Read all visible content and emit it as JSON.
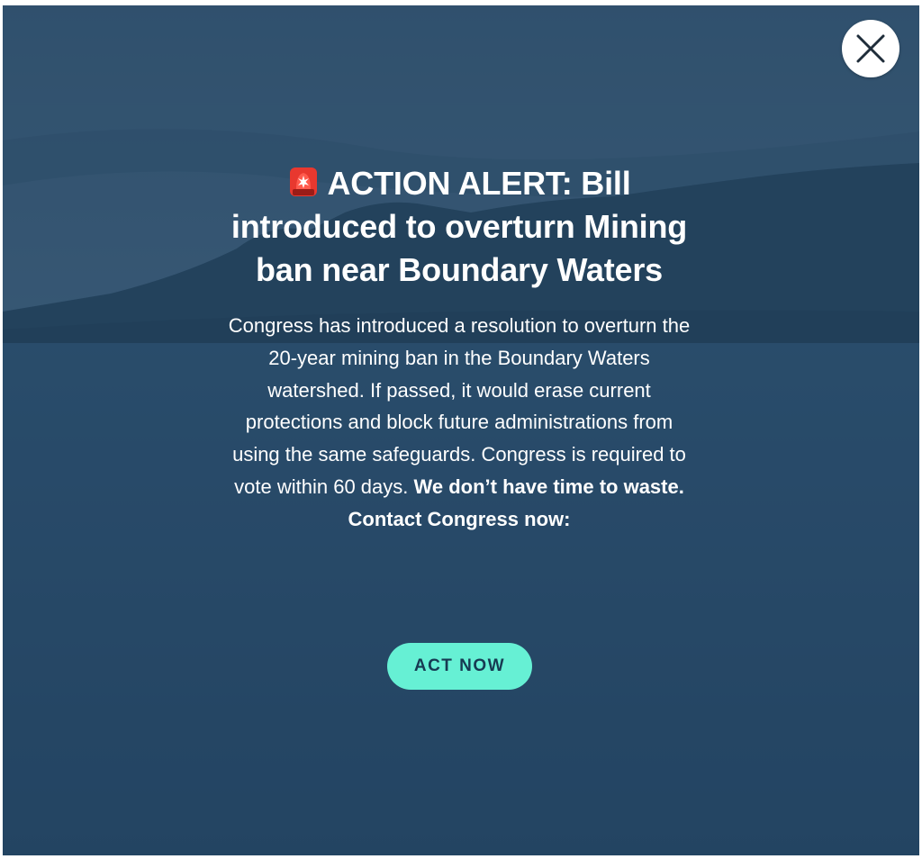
{
  "modal": {
    "headline": "ACTION ALERT: Bill introduced to overturn Mining ban near Boundary Waters",
    "headline_icon": "police-siren-icon",
    "body_text": "Congress has introduced a resolution to overturn the 20-year mining ban in the Boundary Waters watershed. If passed, it would erase current protections and block future administrations from using the same safeguards. Congress is required to vote within 60 days.",
    "body_bold_1": "We don’t have time to waste.",
    "body_bold_2": "Contact Congress now:",
    "cta_label": "ACT NOW",
    "close_icon": "close-icon"
  },
  "colors": {
    "overlay": "#2b4d6c",
    "cta_background": "#66f0d4",
    "cta_text": "#173a52",
    "text": "#ffffff"
  }
}
